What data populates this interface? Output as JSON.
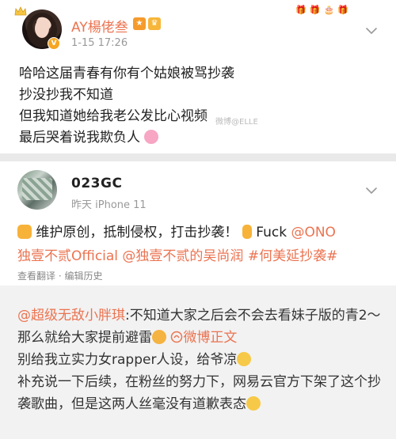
{
  "post1": {
    "username": "AY楊佬叁",
    "time": "1-15 17:26",
    "lines": [
      "哈哈这届青春有你有个姑娘被骂抄袭",
      "抄没抄我不知道",
      "但我知道她给我老公发比心视频",
      "最后哭着说我欺负人"
    ],
    "watermark": "微博@ELLE"
  },
  "post2": {
    "username": "023GC",
    "meta": "昨天  iPhone 11",
    "line1_text": "维护原创，抵制侵权，打击抄袭！",
    "line1_fuck": "Fuck ",
    "line1_mention": "@ONO",
    "line2": "独壹不贰Official @独壹不贰的吴尚润 #何美延抄袭#",
    "actions": "查看翻译 · 编辑历史"
  },
  "repost": {
    "mention": "@超级无敌小胖琪",
    "text_a": ":不知道大家之后会不会去看妹子版的青2～那么就给大家提前避雷",
    "link": "微博正文",
    "line2": "别给我立实力女rapper人设，给爷凉",
    "line3": "补充说一下后续，在粉丝的努力下，网易云官方下架了这个抄袭歌曲，但是这两人丝毫没有道歉表态"
  },
  "colors": {
    "accent": "#eb7350",
    "username_orange": "#eb7350",
    "meta_gray": "#999999",
    "repost_bg": "#f2f2f2",
    "separator": "#e9e9e9"
  },
  "icons": {
    "chevron": "chevron-down-icon",
    "verified": "verified-badge-icon",
    "crown": "crown-icon"
  }
}
